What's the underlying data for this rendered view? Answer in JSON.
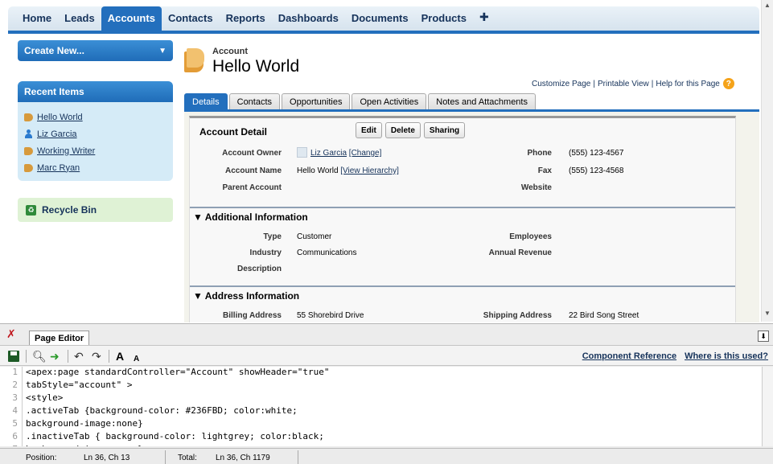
{
  "nav": {
    "tabs": [
      "Home",
      "Leads",
      "Accounts",
      "Contacts",
      "Reports",
      "Dashboards",
      "Documents",
      "Products",
      "✚"
    ],
    "active_index": 2
  },
  "sidebar": {
    "create_new": "Create New...",
    "recent_title": "Recent Items",
    "recent_items": [
      {
        "label": "Hello World",
        "icon": "account-icon"
      },
      {
        "label": "Liz Garcia",
        "icon": "contact-icon"
      },
      {
        "label": "Working Writer",
        "icon": "account-icon"
      },
      {
        "label": "Marc Ryan",
        "icon": "account-icon"
      }
    ],
    "recycle_bin": "Recycle Bin"
  },
  "header": {
    "object_label": "Account",
    "title": "Hello World",
    "help_links": [
      "Customize Page",
      "Printable View",
      "Help for this Page"
    ]
  },
  "detail_tabs": [
    "Details",
    "Contacts",
    "Opportunities",
    "Open Activities",
    "Notes and Attachments"
  ],
  "detail": {
    "title": "Account Detail",
    "buttons": [
      "Edit",
      "Delete",
      "Sharing"
    ],
    "rows": [
      {
        "l1": "Account Owner",
        "v1": "Liz Garcia",
        "v1_link": "[Change]",
        "l2": "Phone",
        "v2": "(555) 123-4567"
      },
      {
        "l1": "Account Name",
        "v1": "Hello World",
        "v1_link": "[View Hierarchy]",
        "l2": "Fax",
        "v2": "(555) 123-4568"
      },
      {
        "l1": "Parent Account",
        "v1": "",
        "v1_link": "",
        "l2": "Website",
        "v2": ""
      }
    ],
    "additional": {
      "title": "▼ Additional Information",
      "rows": [
        {
          "l1": "Type",
          "v1": "Customer",
          "l2": "Employees",
          "v2": ""
        },
        {
          "l1": "Industry",
          "v1": "Communications",
          "l2": "Annual Revenue",
          "v2": ""
        },
        {
          "l1": "Description",
          "v1": "",
          "l2": "",
          "v2": ""
        }
      ]
    },
    "address": {
      "title": "▼ Address Information",
      "rows": [
        {
          "l1": "Billing Address",
          "v1": "55 Shorebird Drive",
          "l2": "Shipping Address",
          "v2": "22 Bird Song Street"
        }
      ]
    }
  },
  "editor": {
    "tab": "Page Editor",
    "links": [
      "Component Reference",
      "Where is this used?"
    ],
    "code": [
      "<apex:page standardController=\"Account\" showHeader=\"true\"",
      "tabStyle=\"account\" >",
      "<style>",
      ".activeTab {background-color: #236FBD; color:white;",
      "background-image:none}",
      ".inactiveTab { background-color: lightgrey; color:black;",
      "background-image:none}"
    ],
    "status": {
      "position_label": "Position:",
      "position_value": "Ln 36, Ch 13",
      "total_label": "Total:",
      "total_value": "Ln 36, Ch 1179"
    }
  },
  "colors": {
    "accent": "#236FBD"
  }
}
